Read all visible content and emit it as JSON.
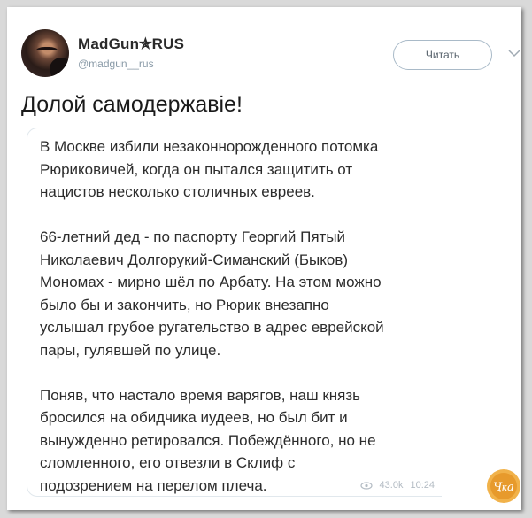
{
  "tweet": {
    "author_name": "MadGun✯RUS",
    "author_handle": "@madgun__rus",
    "follow_label": "Читать",
    "text": "Долой самодержавіе!"
  },
  "media": {
    "text": "В Москве избили незаконнорожденного потомка\nРюриковичей, когда он пытался защитить от\nнацистов несколько столичных евреев.\n\n66-летний дед - по паспорту  Георгий Пятый\nНиколаевич Долгорукий-Симанский (Быков)\nМономах - мирно шёл по Арбату. На этом можно\nбыло бы и закончить, но Рюрик внезапно\nуслышал грубое ругательство в адрес еврейской\nпары, гулявшей по улице.\n\nПоняв, что настало время варягов, наш князь\nбросился на обидчика иудеев, но был бит и\nвынужденно ретировался. Побеждённого, но не\nсломленного, его отвезли в Склиф с\nподозрением на перелом плеча.",
    "views": "43.0k",
    "time": "10:24"
  },
  "watermark": {
    "text": "Ҷҝа",
    "color": "#e79a2c"
  },
  "icons": {
    "dropdown": "chevron-down-icon",
    "views": "eye-icon"
  }
}
